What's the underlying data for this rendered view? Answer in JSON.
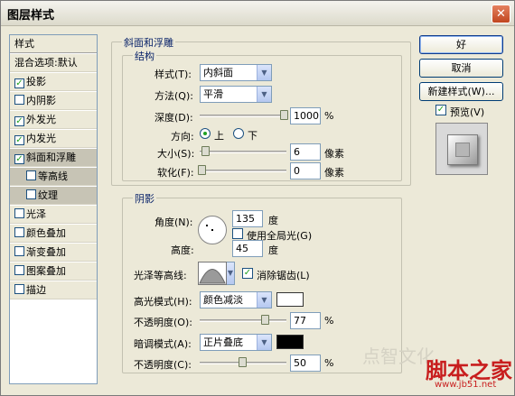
{
  "window": {
    "title": "图层样式",
    "close_icon": "close-icon"
  },
  "left_list": {
    "header": "样式",
    "blend_options": "混合选项:默认",
    "items": [
      {
        "label": "投影",
        "checked": true
      },
      {
        "label": "内阴影",
        "checked": false
      },
      {
        "label": "外发光",
        "checked": true
      },
      {
        "label": "内发光",
        "checked": true
      },
      {
        "label": "斜面和浮雕",
        "checked": true,
        "selected": true
      },
      {
        "label": "等高线",
        "checked": false,
        "sub": true
      },
      {
        "label": "纹理",
        "checked": false,
        "sub": true
      },
      {
        "label": "光泽",
        "checked": false
      },
      {
        "label": "颜色叠加",
        "checked": false
      },
      {
        "label": "渐变叠加",
        "checked": false
      },
      {
        "label": "图案叠加",
        "checked": false
      },
      {
        "label": "描边",
        "checked": false
      }
    ]
  },
  "bevel": {
    "section_title": "斜面和浮雕",
    "structure_title": "结构",
    "style_label": "样式(T):",
    "style_value": "内斜面",
    "method_label": "方法(Q):",
    "method_value": "平滑",
    "depth_label": "深度(D):",
    "depth_value": "1000",
    "depth_unit": "%",
    "direction_label": "方向:",
    "direction_up": "上",
    "direction_down": "下",
    "size_label": "大小(S):",
    "size_value": "6",
    "size_unit": "像素",
    "soften_label": "软化(F):",
    "soften_value": "0",
    "soften_unit": "像素"
  },
  "shading": {
    "title": "阴影",
    "angle_label": "角度(N):",
    "angle_value": "135",
    "angle_unit": "度",
    "global_light_label": "使用全局光(G)",
    "altitude_label": "高度:",
    "altitude_value": "45",
    "altitude_unit": "度",
    "gloss_contour_label": "光泽等高线:",
    "antialias_label": "消除锯齿(L)",
    "highlight_mode_label": "高光模式(H):",
    "highlight_mode_value": "颜色减淡",
    "highlight_color": "#ffffff",
    "highlight_opacity_label": "不透明度(O):",
    "highlight_opacity_value": "77",
    "highlight_opacity_unit": "%",
    "shadow_mode_label": "暗调模式(A):",
    "shadow_mode_value": "正片叠底",
    "shadow_color": "#000000",
    "shadow_opacity_label": "不透明度(C):",
    "shadow_opacity_value": "50",
    "shadow_opacity_unit": "%"
  },
  "buttons": {
    "ok": "好",
    "cancel": "取消",
    "new_style": "新建样式(W)...",
    "preview_label": "预览(V)"
  },
  "watermark": {
    "text": "脚本之家",
    "url": "www.jb51.net",
    "faint": "点智文化"
  }
}
